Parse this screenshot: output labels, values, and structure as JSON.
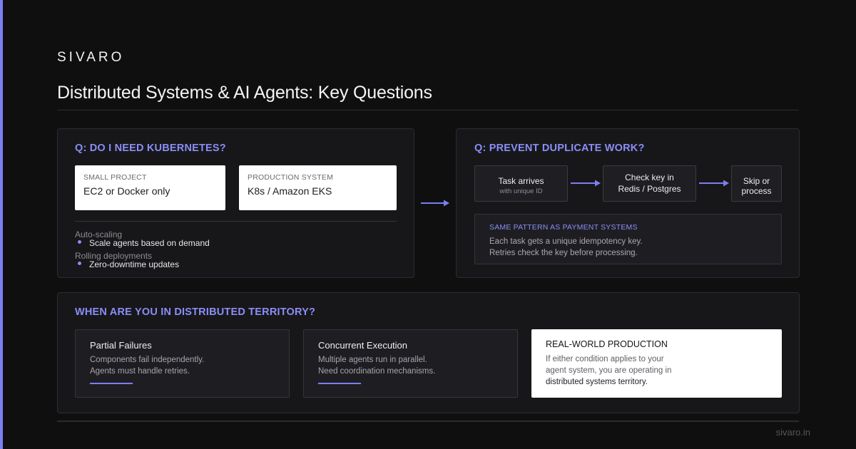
{
  "brand": "SIVARO",
  "title": "Distributed Systems & AI Agents: Key Questions",
  "colors": {
    "accent": "#7b7ff0",
    "heading": "#8a8ef5",
    "background": "#0f0f10",
    "panel": "#17171a"
  },
  "kubernetes": {
    "heading": "Q: DO I NEED KUBERNETES?",
    "small_project": {
      "label": "SMALL PROJECT",
      "value": "EC2 or Docker only"
    },
    "production": {
      "label": "PRODUCTION SYSTEM",
      "value": "K8s / Amazon EKS"
    },
    "features": [
      {
        "label": "Auto-scaling",
        "item": "Scale agents based on demand"
      },
      {
        "label": "Rolling deployments",
        "item": "Zero-downtime updates"
      }
    ]
  },
  "duplicate": {
    "heading": "Q: PREVENT DUPLICATE WORK?",
    "flow": {
      "step1": "Task arrives",
      "step1_sub": "with unique ID",
      "step2_line1": "Check key in",
      "step2_line2": "Redis / Postgres",
      "step3_line1": "Skip or",
      "step3_line2": "process"
    },
    "pattern": {
      "label": "SAME PATTERN AS PAYMENT SYSTEMS",
      "line1": "Each task gets a unique idempotency key.",
      "line2": "Retries check the key before processing."
    }
  },
  "territory": {
    "heading": "WHEN ARE YOU IN DISTRIBUTED TERRITORY?",
    "cards": [
      {
        "title": "Partial Failures",
        "line1": "Components fail independently.",
        "line2": "Agents must handle retries."
      },
      {
        "title": "Concurrent Execution",
        "line1": "Multiple agents run in parallel.",
        "line2": "Need coordination mechanisms."
      }
    ],
    "production": {
      "title": "REAL-WORLD PRODUCTION",
      "line1": "If either condition applies to your",
      "line2": "agent system, you are operating in",
      "line3": "distributed systems territory."
    }
  },
  "footer": "sivaro.in"
}
